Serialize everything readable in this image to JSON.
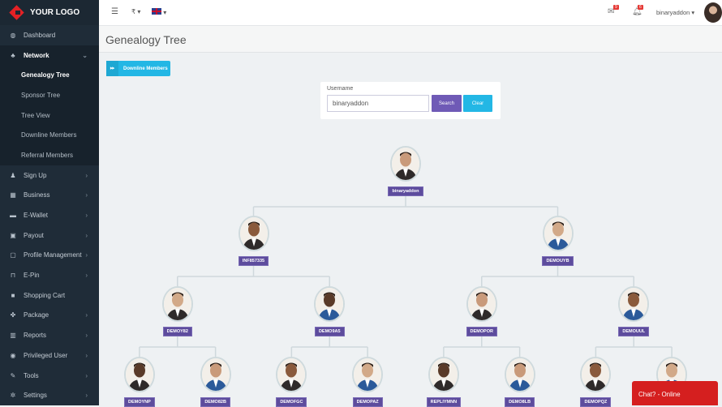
{
  "logo": "YOUR LOGO",
  "sidebar": {
    "items": [
      {
        "label": "Dashboard",
        "icon": "dashboard-icon",
        "glyph": "◍"
      },
      {
        "label": "Network",
        "icon": "network-icon",
        "glyph": "♣",
        "chevron": "⌄",
        "active": true,
        "sub": [
          {
            "label": "Genealogy Tree",
            "active": true
          },
          {
            "label": "Sponsor Tree"
          },
          {
            "label": "Tree View"
          },
          {
            "label": "Downline Members"
          },
          {
            "label": "Referral Members"
          }
        ]
      },
      {
        "label": "Sign Up",
        "icon": "user-plus-icon",
        "glyph": "♟",
        "chevron": "›"
      },
      {
        "label": "Business",
        "icon": "building-icon",
        "glyph": "▦",
        "chevron": "›"
      },
      {
        "label": "E-Wallet",
        "icon": "wallet-icon",
        "glyph": "▬",
        "chevron": "›"
      },
      {
        "label": "Payout",
        "icon": "money-icon",
        "glyph": "▣",
        "chevron": "›"
      },
      {
        "label": "Profile Management",
        "icon": "profile-icon",
        "glyph": "▢",
        "chevron": "›"
      },
      {
        "label": "E-Pin",
        "icon": "bookmark-icon",
        "glyph": "⊓",
        "chevron": "›"
      },
      {
        "label": "Shopping Cart",
        "icon": "shopping-bag-icon",
        "glyph": "■"
      },
      {
        "label": "Package",
        "icon": "package-icon",
        "glyph": "✤",
        "chevron": "›"
      },
      {
        "label": "Reports",
        "icon": "chart-icon",
        "glyph": "▥",
        "chevron": "›"
      },
      {
        "label": "Privileged User",
        "icon": "user-circle-icon",
        "glyph": "◉",
        "chevron": "›"
      },
      {
        "label": "Tools",
        "icon": "wrench-icon",
        "glyph": "✎",
        "chevron": "›"
      },
      {
        "label": "Settings",
        "icon": "cogs-icon",
        "glyph": "✲",
        "chevron": "›"
      }
    ]
  },
  "topbar": {
    "currency": "₹",
    "mail_count": "9",
    "notif_count": "6",
    "username": "binaryaddon"
  },
  "page_title": "Genealogy Tree",
  "downline_button": "Downline Members",
  "search": {
    "label": "Username",
    "value": "binaryaddon",
    "search_btn": "Search",
    "clear_btn": "Clear"
  },
  "tree": [
    [
      "binaryaddon"
    ],
    [
      "INF857335",
      "DEMOUYB"
    ],
    [
      "DEMOY82",
      "DEMO9A5",
      "DEMOPOR",
      "DEMOUUL"
    ],
    [
      "DEMOYNP",
      "DEMO82B",
      "DEMOFGC",
      "DEMOPAZ",
      "REPLIYMNN",
      "DEMO8LB",
      "DEMOPQZ",
      ""
    ]
  ],
  "chat": "Chat? - Online",
  "colors": {
    "accent": "#23b7e5",
    "purple": "#6f5ab6",
    "tag": "#5d4c9d",
    "chat": "#d51f1f"
  }
}
